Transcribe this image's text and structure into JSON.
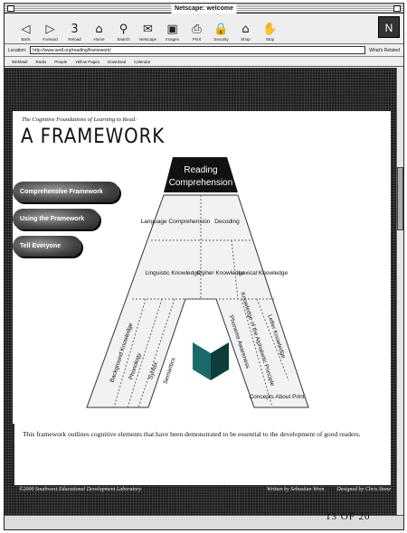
{
  "window": {
    "title": "Netscape: welcome"
  },
  "toolbar": {
    "buttons": [
      {
        "label": "Back",
        "icon": "back-arrow-icon",
        "glyph": "◁"
      },
      {
        "label": "Forward",
        "icon": "forward-arrow-icon",
        "glyph": "▷"
      },
      {
        "label": "Reload",
        "icon": "reload-icon",
        "glyph": "3"
      },
      {
        "label": "Home",
        "icon": "home-icon",
        "glyph": "⌂"
      },
      {
        "label": "Search",
        "icon": "search-icon",
        "glyph": "⚲"
      },
      {
        "label": "Netscape",
        "icon": "netscape-icon",
        "glyph": "✉"
      },
      {
        "label": "Images",
        "icon": "images-icon",
        "glyph": "▣"
      },
      {
        "label": "Print",
        "icon": "print-icon",
        "glyph": "⎙"
      },
      {
        "label": "Security",
        "icon": "security-icon",
        "glyph": "🔒"
      },
      {
        "label": "Shop",
        "icon": "shop-icon",
        "glyph": "⌂"
      },
      {
        "label": "Stop",
        "icon": "stop-icon",
        "glyph": "✋"
      }
    ]
  },
  "location": {
    "label": "Location:",
    "url": "http://www.sedl.org/reading/framework/",
    "related": "What's Related"
  },
  "personal_toolbar": [
    "WebMail",
    "Radio",
    "People",
    "Yellow Pages",
    "Download",
    "Calendar"
  ],
  "page": {
    "subtitle": "The Cognitive Foundations of Learning to Read:",
    "title": "A FRAMEWORK",
    "nav": [
      "Comprehensive Framework",
      "Using the Framework",
      "Tell Everyone"
    ],
    "apex": "Reading Comprehension",
    "left_branch": "Language Comprehension",
    "right_branch": "Decoding",
    "mid_left": "Linguistic Knowledge",
    "mid_c1": "Cipher Knowledge",
    "mid_c2": "Lexical Knowledge",
    "left_leg": [
      "Background Knowledge",
      "Phonology",
      "Syntax",
      "Semantics"
    ],
    "right_leg": [
      "Phoneme Awareness",
      "Knowledge of the Alphabetic Principle",
      "Letter Knowledge",
      "Concepts About Print"
    ],
    "description": "This framework outlines cognitive elements that have been demonstrated to be essential to the development of good readers.",
    "footer_left": "©2000 Southwest Educational Development Laboratory",
    "footer_written": "Written by Sebastian Wren",
    "footer_designed": "Designed by Chris Stone"
  },
  "page_number": "13 OF 20"
}
